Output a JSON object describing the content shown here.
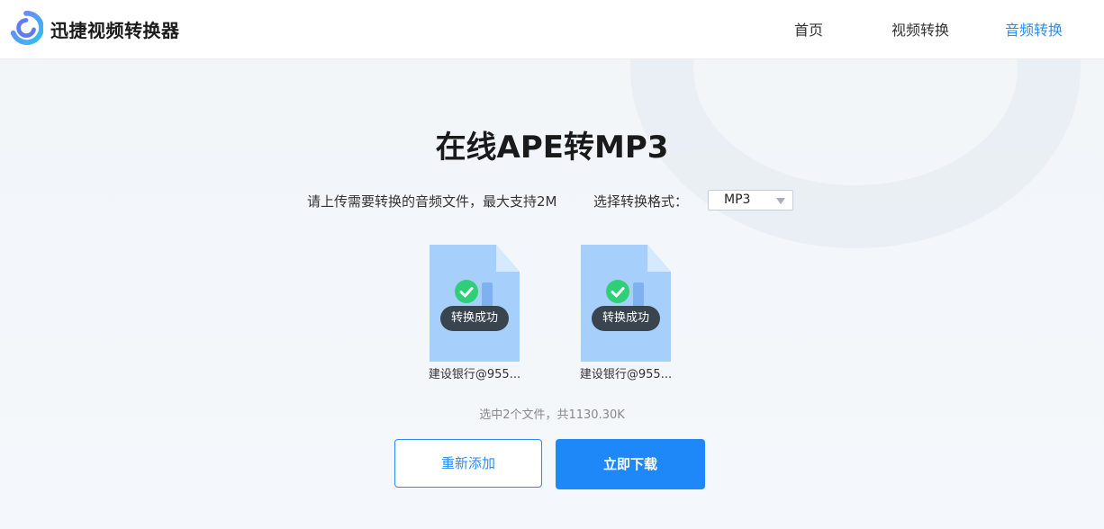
{
  "header": {
    "brand": "迅捷视频转换器",
    "nav": [
      "首页",
      "视频转换",
      "音频转换"
    ],
    "active_nav": "音频转换",
    "accent": "#2d8cf0"
  },
  "main": {
    "title": "在线APE转MP3",
    "hint": "请上传需要转换的音频文件，最大支持2M",
    "format_label": "选择转换格式：",
    "format_value": "MP3",
    "files": [
      {
        "name": "建设银行@955...",
        "status": "转换成功",
        "icon": "audio-file-icon"
      },
      {
        "name": "建设银行@955...",
        "status": "转换成功",
        "icon": "audio-file-icon"
      }
    ],
    "summary": "选中2个文件，共1130.30K",
    "readd_label": "重新添加",
    "download_label": "立即下载",
    "download_color": "#1e88f8",
    "success_color": "#2fcf78"
  }
}
